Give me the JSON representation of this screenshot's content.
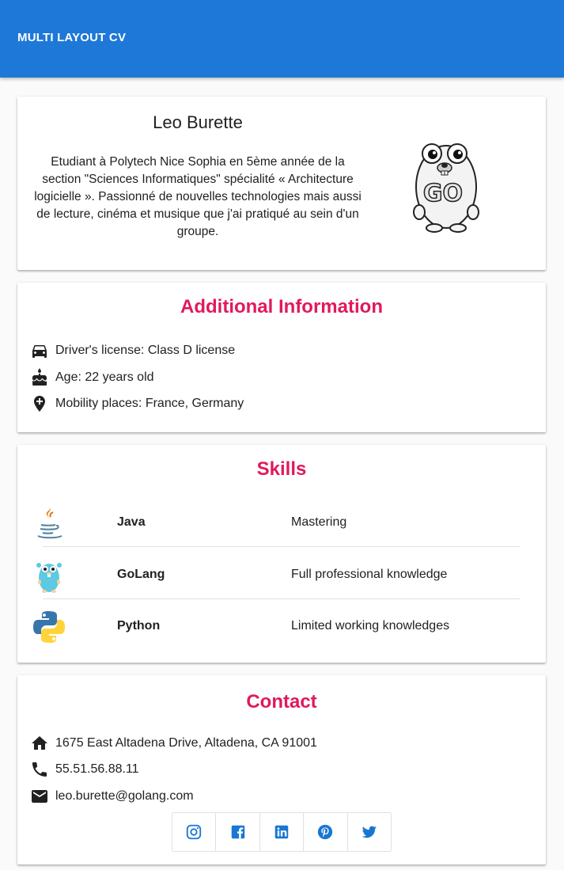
{
  "app": {
    "title": "MULTI LAYOUT CV"
  },
  "profile": {
    "name": "Leo Burette",
    "bio": "Etudiant à Polytech Nice Sophia en 5ème année de la section \"Sciences Informatiques\" spécialité « Architecture logicielle ». Passionné de nouvelles technologies mais aussi de lecture, cinéma et musique que j'ai pratiqué au sein d'un groupe.",
    "image_text": "GO"
  },
  "additional": {
    "title": "Additional Information",
    "items": [
      {
        "icon": "car-icon",
        "text": "Driver's license: Class D license"
      },
      {
        "icon": "cake-icon",
        "text": "Age: 22 years old"
      },
      {
        "icon": "place-icon",
        "text": "Mobility places: France, Germany"
      }
    ]
  },
  "skills": {
    "title": "Skills",
    "items": [
      {
        "icon": "java-icon",
        "name": "Java",
        "level": "Mastering"
      },
      {
        "icon": "golang-icon",
        "name": "GoLang",
        "level": "Full professional knowledge"
      },
      {
        "icon": "python-icon",
        "name": "Python",
        "level": "Limited working knowledges"
      }
    ]
  },
  "contact": {
    "title": "Contact",
    "items": [
      {
        "icon": "home-icon",
        "text": "1675 East Altadena Drive, Altadena, CA 91001"
      },
      {
        "icon": "phone-icon",
        "text": "55.51.56.88.11"
      },
      {
        "icon": "email-icon",
        "text": "leo.burette@golang.com"
      }
    ],
    "social": [
      "instagram-icon",
      "facebook-icon",
      "linkedin-icon",
      "pinterest-icon",
      "twitter-icon"
    ]
  },
  "colors": {
    "app_bar": "#1e78d7",
    "section_title": "#e0195f",
    "social_icon": "#1976d2"
  }
}
